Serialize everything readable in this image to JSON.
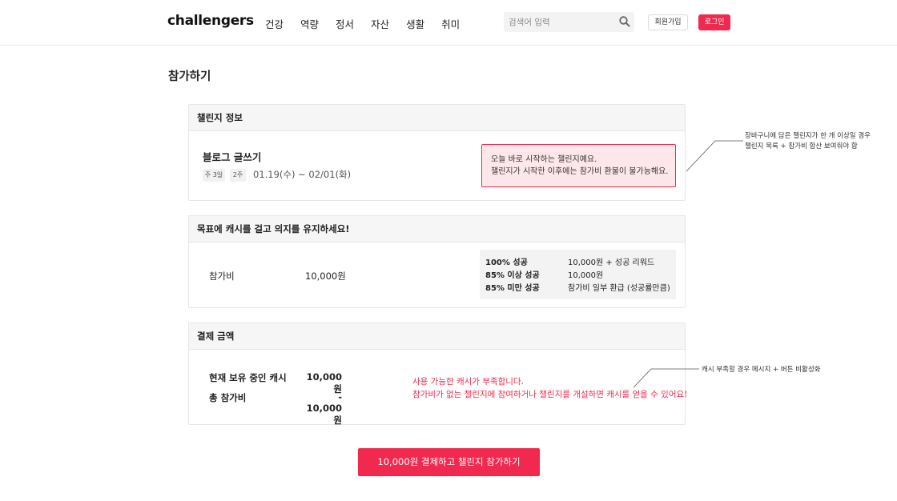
{
  "header": {
    "logo": "challengers",
    "nav": [
      "건강",
      "역량",
      "정서",
      "자산",
      "생활",
      "취미"
    ],
    "search_placeholder": "검색어 입력",
    "join_label": "회원가입",
    "login_label": "로그인"
  },
  "page_title": "참가하기",
  "challenge_info": {
    "heading": "챌린지 정보",
    "name": "블로그 글쓰기",
    "tags": [
      "주 3일",
      "2주"
    ],
    "period": "01.19(수) ~ 02/01(화)",
    "notice": [
      "오늘 바로 시작하는 챌린지예요.",
      "챌린지가 시작한 이후에는 참가비 환불이 불가능해요."
    ]
  },
  "fee_section": {
    "heading": "목표에 캐시를 걸고 의지를 유지하세요!",
    "fee_label": "참가비",
    "fee_value": "10,000원",
    "rewards": [
      {
        "condition": "100% 성공",
        "result": "10,000원 + 성공 리워드"
      },
      {
        "condition": "85% 이상 성공",
        "result": "10,000원"
      },
      {
        "condition": "85% 미만 성공",
        "result": "참가비 일부 환급 (성공률만큼)"
      }
    ]
  },
  "payment": {
    "heading": "결제 금액",
    "rows": [
      {
        "label": "현재 보유 중인 캐시",
        "value": "10,000원"
      },
      {
        "label": "총 참가비",
        "value": "- 10,000원"
      }
    ],
    "warning": [
      "사용 가능한 캐시가 부족합니다.",
      "참가비가 없는 챌린지에 참여하거나 챌린지를 개설하면 캐시를 얻을 수 있어요!"
    ]
  },
  "cta_label": "10,000원 결제하고 챌린지 참가하기",
  "annotations": {
    "top": [
      "장바구니에 담은 챌린지가 한 개 이상일 경우",
      "챌린지 목록 + 참가비 합산 보여줘야 함"
    ],
    "bottom": "캐시 부족할 경우 메시지 + 버튼 비활성화"
  },
  "colors": {
    "accent": "#f2294e",
    "notice_bg": "#fde7ea",
    "card_head_bg": "#f6f6f6"
  }
}
